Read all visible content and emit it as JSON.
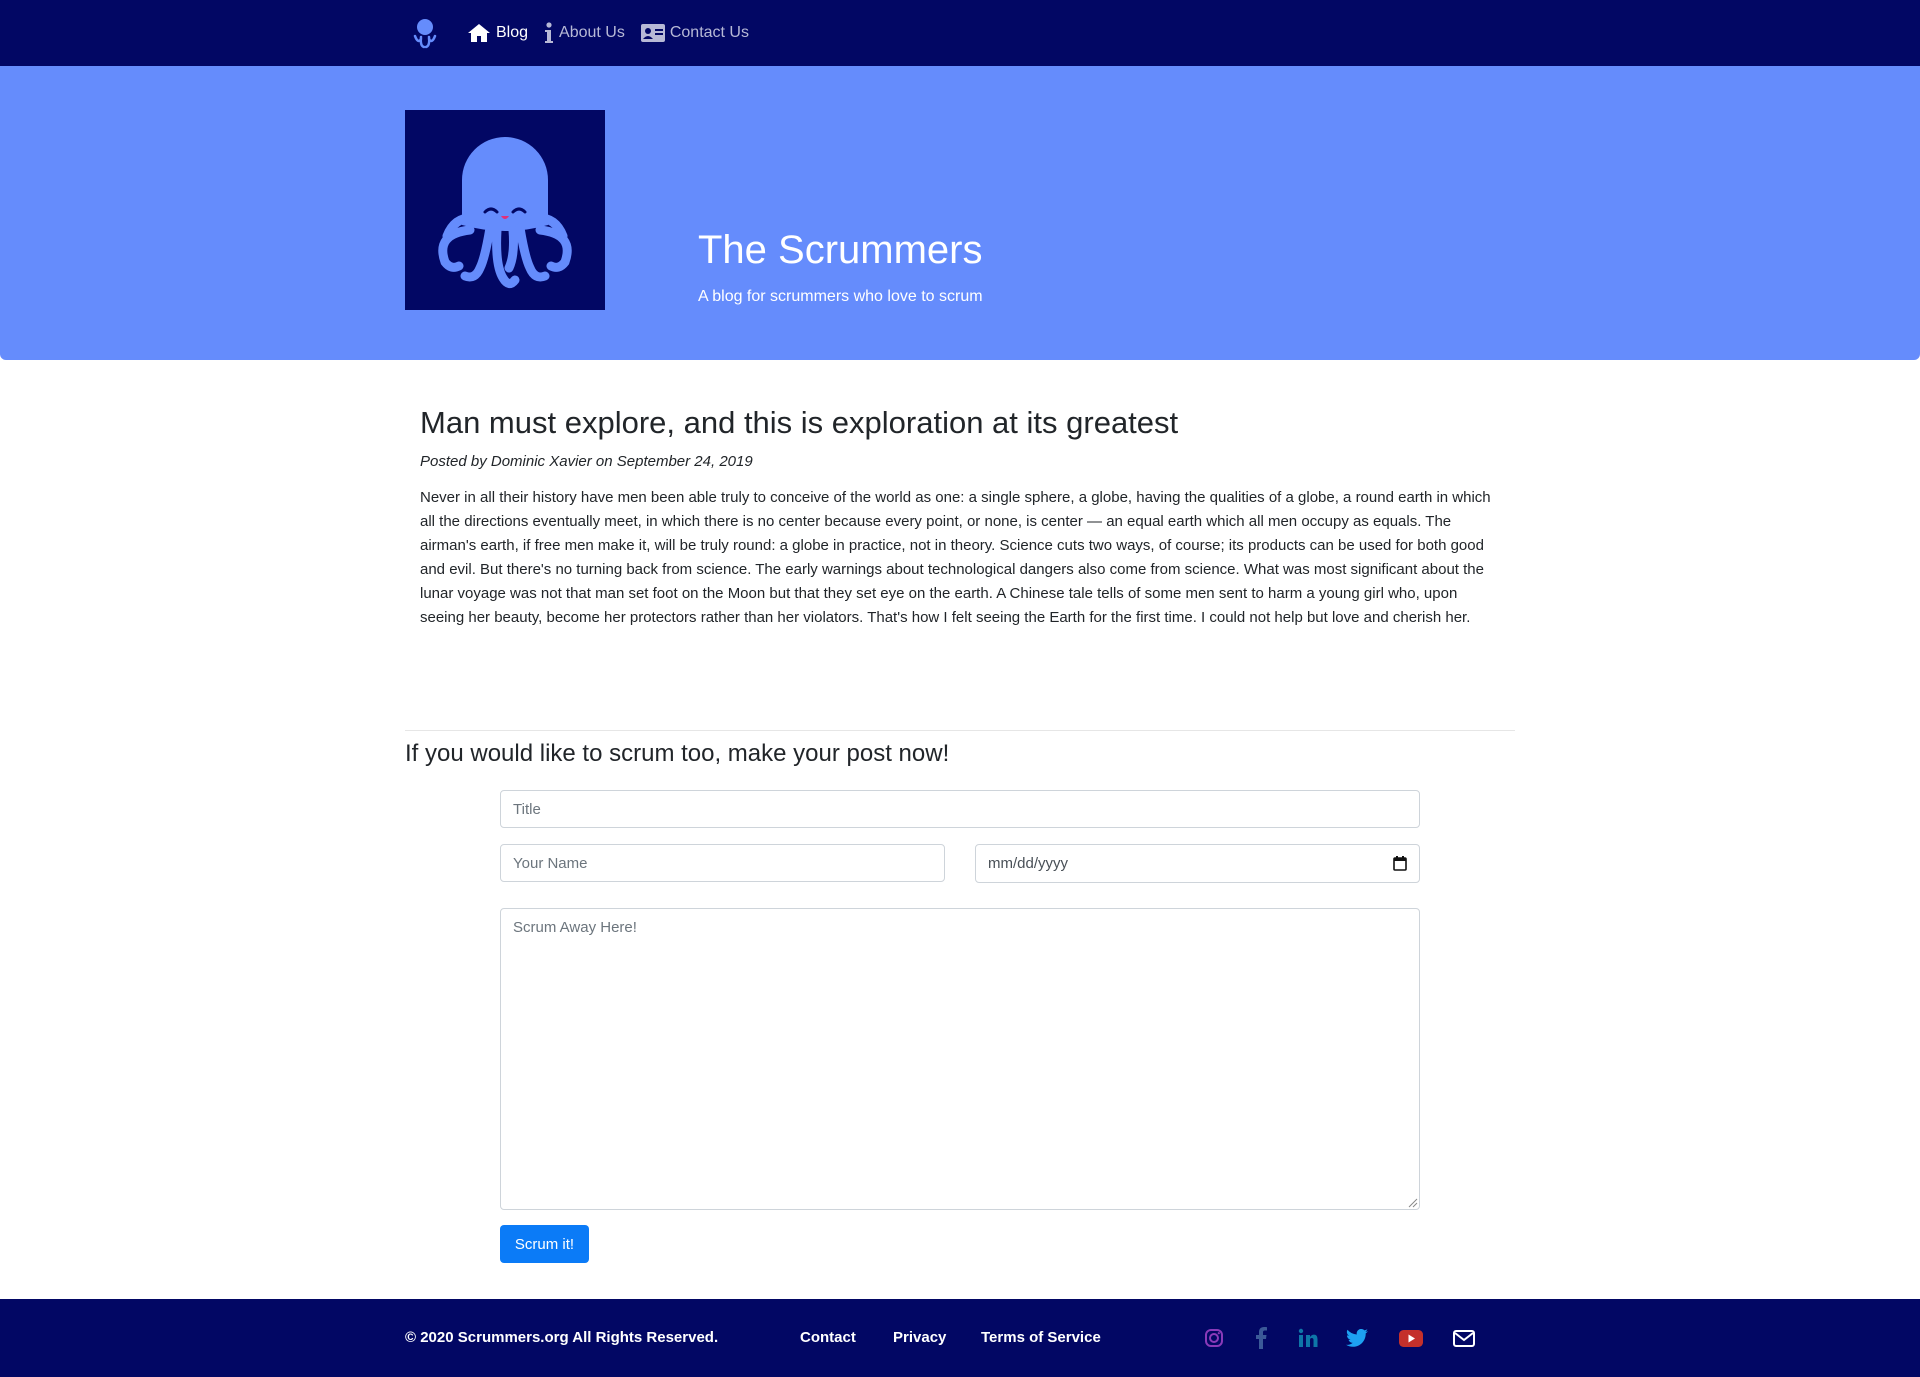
{
  "nav": {
    "brand": "octopus-logo",
    "items": [
      {
        "label": "Blog",
        "icon": "home-icon",
        "active": true
      },
      {
        "label": "About Us",
        "icon": "info-icon",
        "active": false
      },
      {
        "label": "Contact Us",
        "icon": "address-card-icon",
        "active": false
      }
    ]
  },
  "hero": {
    "title": "The Scrummers",
    "subtitle": "A blog for scrummers who love to scrum"
  },
  "post": {
    "title": "Man must explore, and this is exploration at its greatest",
    "meta": "Posted by Dominic Xavier on September 24, 2019",
    "body": "Never in all their history have men been able truly to conceive of the world as one: a single sphere, a globe, having the qualities of a globe, a round earth in which all the directions eventually meet, in which there is no center because every point, or none, is center — an equal earth which all men occupy as equals. The airman's earth, if free men make it, will be truly round: a globe in practice, not in theory. Science cuts two ways, of course; its products can be used for both good and evil. But there's no turning back from science. The early warnings about technological dangers also come from science. What was most significant about the lunar voyage was not that man set foot on the Moon but that they set eye on the earth. A Chinese tale tells of some men sent to harm a young girl who, upon seeing her beauty, become her protectors rather than her violators. That's how I felt seeing the Earth for the first time. I could not help but love and cherish her."
  },
  "form": {
    "heading": "If you would like to scrum too, make your post now!",
    "title_placeholder": "Title",
    "name_placeholder": "Your Name",
    "date_placeholder": "mm/dd/yyyy",
    "body_placeholder": "Scrum Away Here!",
    "submit_label": "Scrum it!"
  },
  "footer": {
    "copyright": "© 2020 Scrummers.org All Rights Reserved.",
    "links": [
      "Contact",
      "Privacy",
      "Terms of Service"
    ],
    "social": [
      {
        "icon": "instagram-icon",
        "color": "#8a3ab9"
      },
      {
        "icon": "facebook-icon",
        "color": "#3b5998"
      },
      {
        "icon": "linkedin-icon",
        "color": "#0e76a8"
      },
      {
        "icon": "twitter-icon",
        "color": "#1da1f2"
      },
      {
        "icon": "youtube-icon",
        "color": "#c4302b"
      },
      {
        "icon": "envelope-icon",
        "color": "#ffffff"
      }
    ]
  },
  "colors": {
    "navbar": "#020764",
    "hero": "#658cfc",
    "button": "#0b7bf7"
  }
}
